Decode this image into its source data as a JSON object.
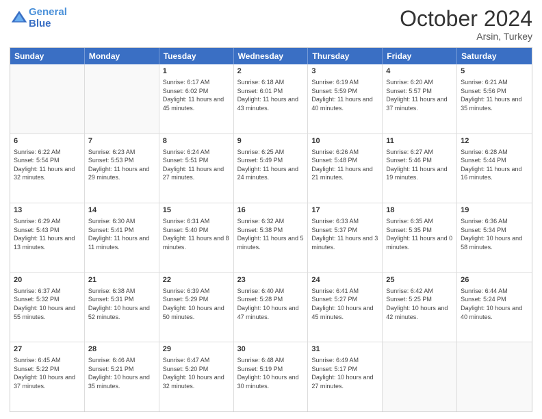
{
  "header": {
    "logo_line1": "General",
    "logo_line2": "Blue",
    "title": "October 2024",
    "subtitle": "Arsin, Turkey"
  },
  "days": [
    "Sunday",
    "Monday",
    "Tuesday",
    "Wednesday",
    "Thursday",
    "Friday",
    "Saturday"
  ],
  "weeks": [
    [
      {
        "date": "",
        "sunrise": "",
        "sunset": "",
        "daylight": ""
      },
      {
        "date": "",
        "sunrise": "",
        "sunset": "",
        "daylight": ""
      },
      {
        "date": "1",
        "sunrise": "Sunrise: 6:17 AM",
        "sunset": "Sunset: 6:02 PM",
        "daylight": "Daylight: 11 hours and 45 minutes."
      },
      {
        "date": "2",
        "sunrise": "Sunrise: 6:18 AM",
        "sunset": "Sunset: 6:01 PM",
        "daylight": "Daylight: 11 hours and 43 minutes."
      },
      {
        "date": "3",
        "sunrise": "Sunrise: 6:19 AM",
        "sunset": "Sunset: 5:59 PM",
        "daylight": "Daylight: 11 hours and 40 minutes."
      },
      {
        "date": "4",
        "sunrise": "Sunrise: 6:20 AM",
        "sunset": "Sunset: 5:57 PM",
        "daylight": "Daylight: 11 hours and 37 minutes."
      },
      {
        "date": "5",
        "sunrise": "Sunrise: 6:21 AM",
        "sunset": "Sunset: 5:56 PM",
        "daylight": "Daylight: 11 hours and 35 minutes."
      }
    ],
    [
      {
        "date": "6",
        "sunrise": "Sunrise: 6:22 AM",
        "sunset": "Sunset: 5:54 PM",
        "daylight": "Daylight: 11 hours and 32 minutes."
      },
      {
        "date": "7",
        "sunrise": "Sunrise: 6:23 AM",
        "sunset": "Sunset: 5:53 PM",
        "daylight": "Daylight: 11 hours and 29 minutes."
      },
      {
        "date": "8",
        "sunrise": "Sunrise: 6:24 AM",
        "sunset": "Sunset: 5:51 PM",
        "daylight": "Daylight: 11 hours and 27 minutes."
      },
      {
        "date": "9",
        "sunrise": "Sunrise: 6:25 AM",
        "sunset": "Sunset: 5:49 PM",
        "daylight": "Daylight: 11 hours and 24 minutes."
      },
      {
        "date": "10",
        "sunrise": "Sunrise: 6:26 AM",
        "sunset": "Sunset: 5:48 PM",
        "daylight": "Daylight: 11 hours and 21 minutes."
      },
      {
        "date": "11",
        "sunrise": "Sunrise: 6:27 AM",
        "sunset": "Sunset: 5:46 PM",
        "daylight": "Daylight: 11 hours and 19 minutes."
      },
      {
        "date": "12",
        "sunrise": "Sunrise: 6:28 AM",
        "sunset": "Sunset: 5:44 PM",
        "daylight": "Daylight: 11 hours and 16 minutes."
      }
    ],
    [
      {
        "date": "13",
        "sunrise": "Sunrise: 6:29 AM",
        "sunset": "Sunset: 5:43 PM",
        "daylight": "Daylight: 11 hours and 13 minutes."
      },
      {
        "date": "14",
        "sunrise": "Sunrise: 6:30 AM",
        "sunset": "Sunset: 5:41 PM",
        "daylight": "Daylight: 11 hours and 11 minutes."
      },
      {
        "date": "15",
        "sunrise": "Sunrise: 6:31 AM",
        "sunset": "Sunset: 5:40 PM",
        "daylight": "Daylight: 11 hours and 8 minutes."
      },
      {
        "date": "16",
        "sunrise": "Sunrise: 6:32 AM",
        "sunset": "Sunset: 5:38 PM",
        "daylight": "Daylight: 11 hours and 5 minutes."
      },
      {
        "date": "17",
        "sunrise": "Sunrise: 6:33 AM",
        "sunset": "Sunset: 5:37 PM",
        "daylight": "Daylight: 11 hours and 3 minutes."
      },
      {
        "date": "18",
        "sunrise": "Sunrise: 6:35 AM",
        "sunset": "Sunset: 5:35 PM",
        "daylight": "Daylight: 11 hours and 0 minutes."
      },
      {
        "date": "19",
        "sunrise": "Sunrise: 6:36 AM",
        "sunset": "Sunset: 5:34 PM",
        "daylight": "Daylight: 10 hours and 58 minutes."
      }
    ],
    [
      {
        "date": "20",
        "sunrise": "Sunrise: 6:37 AM",
        "sunset": "Sunset: 5:32 PM",
        "daylight": "Daylight: 10 hours and 55 minutes."
      },
      {
        "date": "21",
        "sunrise": "Sunrise: 6:38 AM",
        "sunset": "Sunset: 5:31 PM",
        "daylight": "Daylight: 10 hours and 52 minutes."
      },
      {
        "date": "22",
        "sunrise": "Sunrise: 6:39 AM",
        "sunset": "Sunset: 5:29 PM",
        "daylight": "Daylight: 10 hours and 50 minutes."
      },
      {
        "date": "23",
        "sunrise": "Sunrise: 6:40 AM",
        "sunset": "Sunset: 5:28 PM",
        "daylight": "Daylight: 10 hours and 47 minutes."
      },
      {
        "date": "24",
        "sunrise": "Sunrise: 6:41 AM",
        "sunset": "Sunset: 5:27 PM",
        "daylight": "Daylight: 10 hours and 45 minutes."
      },
      {
        "date": "25",
        "sunrise": "Sunrise: 6:42 AM",
        "sunset": "Sunset: 5:25 PM",
        "daylight": "Daylight: 10 hours and 42 minutes."
      },
      {
        "date": "26",
        "sunrise": "Sunrise: 6:44 AM",
        "sunset": "Sunset: 5:24 PM",
        "daylight": "Daylight: 10 hours and 40 minutes."
      }
    ],
    [
      {
        "date": "27",
        "sunrise": "Sunrise: 6:45 AM",
        "sunset": "Sunset: 5:22 PM",
        "daylight": "Daylight: 10 hours and 37 minutes."
      },
      {
        "date": "28",
        "sunrise": "Sunrise: 6:46 AM",
        "sunset": "Sunset: 5:21 PM",
        "daylight": "Daylight: 10 hours and 35 minutes."
      },
      {
        "date": "29",
        "sunrise": "Sunrise: 6:47 AM",
        "sunset": "Sunset: 5:20 PM",
        "daylight": "Daylight: 10 hours and 32 minutes."
      },
      {
        "date": "30",
        "sunrise": "Sunrise: 6:48 AM",
        "sunset": "Sunset: 5:19 PM",
        "daylight": "Daylight: 10 hours and 30 minutes."
      },
      {
        "date": "31",
        "sunrise": "Sunrise: 6:49 AM",
        "sunset": "Sunset: 5:17 PM",
        "daylight": "Daylight: 10 hours and 27 minutes."
      },
      {
        "date": "",
        "sunrise": "",
        "sunset": "",
        "daylight": ""
      },
      {
        "date": "",
        "sunrise": "",
        "sunset": "",
        "daylight": ""
      }
    ]
  ]
}
